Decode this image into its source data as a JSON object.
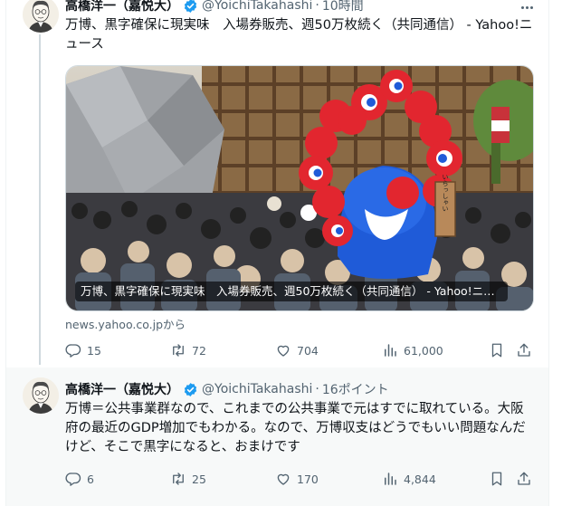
{
  "post": {
    "author_name": "高橋洋一（嘉悦大）",
    "handle": "@YoichiTakahashi",
    "separator": "·",
    "time": "10時間",
    "text": "万博、黒字確保に現実味　入場券販売、週50万枚続く（共同通信） - Yahoo!ニュース",
    "card": {
      "caption": "万博、黒字確保に現実味　入場券販売、週50万枚続く（共同通信） - Yahoo!ニュース",
      "sign_text": "いらっしゃい",
      "source": "news.yahoo.co.jpから"
    },
    "actions": {
      "replies": "15",
      "reposts": "72",
      "likes": "704",
      "views": "61,000"
    }
  },
  "reply": {
    "author_name": "高橋洋一（嘉悦大）",
    "handle": "@YoichiTakahashi",
    "separator": "·",
    "meta": "16ポイント",
    "text": "万博＝公共事業群なので、これまでの公共事業で元はすでに取れている。大阪府の最近のGDP増加でもわかる。なので、万博収支はどうでもいい問題なんだけど、そこで黒字になると、おまけです",
    "actions": {
      "replies": "6",
      "reposts": "25",
      "likes": "170",
      "views": "4,844"
    }
  },
  "colors": {
    "verified": "#1d9bf0",
    "muted": "#536471",
    "text": "#0f1419",
    "mascot_red": "#e2262f",
    "mascot_blue": "#1f5bd8"
  },
  "icons": [
    "verified-badge-icon",
    "more-icon",
    "reply-icon",
    "repost-icon",
    "like-icon",
    "views-icon",
    "bookmark-icon",
    "share-icon"
  ]
}
